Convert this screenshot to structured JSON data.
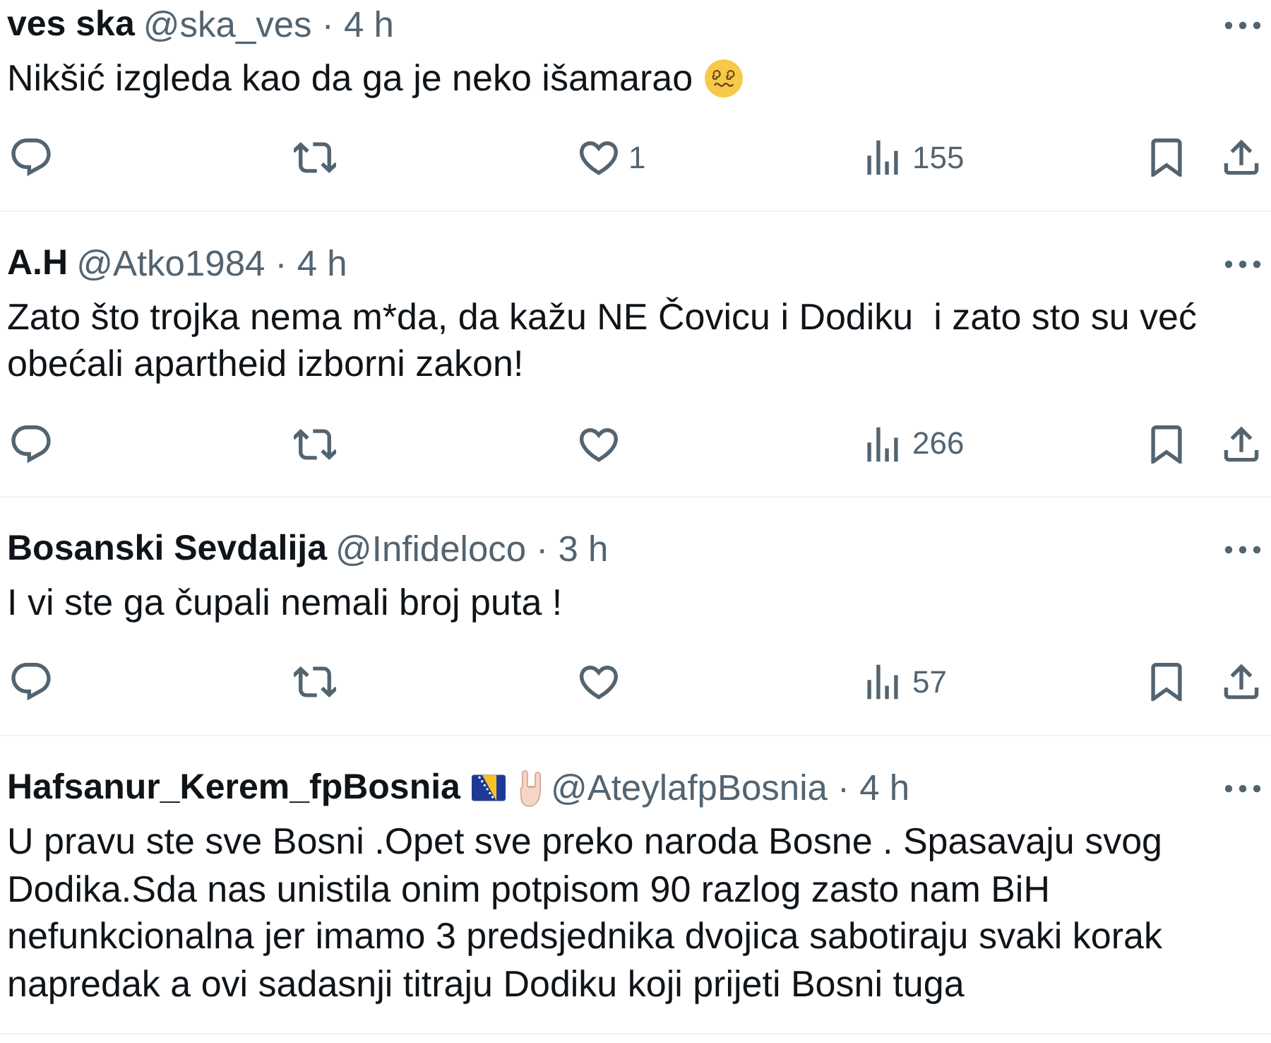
{
  "tweets": [
    {
      "name": "ves ska",
      "meta": "@ska_ves · 4 h",
      "body": "Nikšić izgleda kao da ga je neko išamarao",
      "body_emoji": [
        {
          "kind": "dizzy-face"
        }
      ],
      "actions": [
        {
          "kind": "reply"
        },
        {
          "kind": "repost"
        },
        {
          "kind": "like",
          "liked": false,
          "count": "1"
        },
        {
          "kind": "views",
          "count": "155"
        },
        {
          "kind": "bookmark"
        },
        {
          "kind": "share"
        }
      ]
    },
    {
      "name": "A.H",
      "meta": "@Atko1984 · 4 h",
      "body": "Zato što trojka nema m*da, da kažu NE Čovicu i Dodiku  i zato sto su već obećali apartheid izborni zakon!",
      "actions": [
        {
          "kind": "reply"
        },
        {
          "kind": "repost"
        },
        {
          "kind": "like",
          "liked": false
        },
        {
          "kind": "views",
          "count": "266"
        },
        {
          "kind": "bookmark"
        },
        {
          "kind": "share"
        }
      ]
    },
    {
      "name": "Bosanski Sevdalija",
      "meta": "@Infideloco · 3 h",
      "body": "I vi ste ga čupali nemali broj puta !",
      "actions": [
        {
          "kind": "reply"
        },
        {
          "kind": "repost"
        },
        {
          "kind": "like",
          "liked": false
        },
        {
          "kind": "views",
          "count": "57"
        },
        {
          "kind": "bookmark"
        },
        {
          "kind": "share"
        }
      ]
    },
    {
      "name": "Hafsanur_Kerem_fpBosnia",
      "name_emoji": [
        {
          "kind": "flag"
        },
        {
          "kind": "rock-hand"
        }
      ],
      "meta": "@AteylafpBosnia · 4 h",
      "body": "U pravu ste sve Bosni .Opet sve preko naroda Bosne . Spasavaju svog Dodika.Sda nas unistila onim potpisom 90 razlog zasto nam BiH nefunkcionalna jer imamo 3 predsjednika dvojica sabotiraju svaki korak napredak a ovi sadasnji titraju Dodiku koji prijeti Bosni tuga"
    }
  ]
}
